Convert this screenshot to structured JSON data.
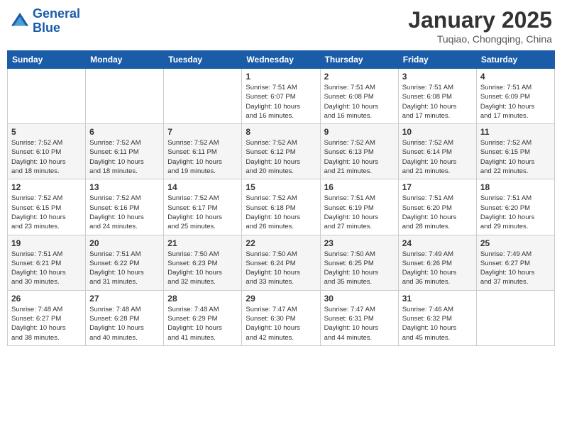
{
  "header": {
    "logo_line1": "General",
    "logo_line2": "Blue",
    "month_title": "January 2025",
    "subtitle": "Tuqiao, Chongqing, China"
  },
  "days_of_week": [
    "Sunday",
    "Monday",
    "Tuesday",
    "Wednesday",
    "Thursday",
    "Friday",
    "Saturday"
  ],
  "weeks": [
    [
      {
        "day": "",
        "info": ""
      },
      {
        "day": "",
        "info": ""
      },
      {
        "day": "",
        "info": ""
      },
      {
        "day": "1",
        "info": "Sunrise: 7:51 AM\nSunset: 6:07 PM\nDaylight: 10 hours\nand 16 minutes."
      },
      {
        "day": "2",
        "info": "Sunrise: 7:51 AM\nSunset: 6:08 PM\nDaylight: 10 hours\nand 16 minutes."
      },
      {
        "day": "3",
        "info": "Sunrise: 7:51 AM\nSunset: 6:08 PM\nDaylight: 10 hours\nand 17 minutes."
      },
      {
        "day": "4",
        "info": "Sunrise: 7:51 AM\nSunset: 6:09 PM\nDaylight: 10 hours\nand 17 minutes."
      }
    ],
    [
      {
        "day": "5",
        "info": "Sunrise: 7:52 AM\nSunset: 6:10 PM\nDaylight: 10 hours\nand 18 minutes."
      },
      {
        "day": "6",
        "info": "Sunrise: 7:52 AM\nSunset: 6:11 PM\nDaylight: 10 hours\nand 18 minutes."
      },
      {
        "day": "7",
        "info": "Sunrise: 7:52 AM\nSunset: 6:11 PM\nDaylight: 10 hours\nand 19 minutes."
      },
      {
        "day": "8",
        "info": "Sunrise: 7:52 AM\nSunset: 6:12 PM\nDaylight: 10 hours\nand 20 minutes."
      },
      {
        "day": "9",
        "info": "Sunrise: 7:52 AM\nSunset: 6:13 PM\nDaylight: 10 hours\nand 21 minutes."
      },
      {
        "day": "10",
        "info": "Sunrise: 7:52 AM\nSunset: 6:14 PM\nDaylight: 10 hours\nand 21 minutes."
      },
      {
        "day": "11",
        "info": "Sunrise: 7:52 AM\nSunset: 6:15 PM\nDaylight: 10 hours\nand 22 minutes."
      }
    ],
    [
      {
        "day": "12",
        "info": "Sunrise: 7:52 AM\nSunset: 6:15 PM\nDaylight: 10 hours\nand 23 minutes."
      },
      {
        "day": "13",
        "info": "Sunrise: 7:52 AM\nSunset: 6:16 PM\nDaylight: 10 hours\nand 24 minutes."
      },
      {
        "day": "14",
        "info": "Sunrise: 7:52 AM\nSunset: 6:17 PM\nDaylight: 10 hours\nand 25 minutes."
      },
      {
        "day": "15",
        "info": "Sunrise: 7:52 AM\nSunset: 6:18 PM\nDaylight: 10 hours\nand 26 minutes."
      },
      {
        "day": "16",
        "info": "Sunrise: 7:51 AM\nSunset: 6:19 PM\nDaylight: 10 hours\nand 27 minutes."
      },
      {
        "day": "17",
        "info": "Sunrise: 7:51 AM\nSunset: 6:20 PM\nDaylight: 10 hours\nand 28 minutes."
      },
      {
        "day": "18",
        "info": "Sunrise: 7:51 AM\nSunset: 6:20 PM\nDaylight: 10 hours\nand 29 minutes."
      }
    ],
    [
      {
        "day": "19",
        "info": "Sunrise: 7:51 AM\nSunset: 6:21 PM\nDaylight: 10 hours\nand 30 minutes."
      },
      {
        "day": "20",
        "info": "Sunrise: 7:51 AM\nSunset: 6:22 PM\nDaylight: 10 hours\nand 31 minutes."
      },
      {
        "day": "21",
        "info": "Sunrise: 7:50 AM\nSunset: 6:23 PM\nDaylight: 10 hours\nand 32 minutes."
      },
      {
        "day": "22",
        "info": "Sunrise: 7:50 AM\nSunset: 6:24 PM\nDaylight: 10 hours\nand 33 minutes."
      },
      {
        "day": "23",
        "info": "Sunrise: 7:50 AM\nSunset: 6:25 PM\nDaylight: 10 hours\nand 35 minutes."
      },
      {
        "day": "24",
        "info": "Sunrise: 7:49 AM\nSunset: 6:26 PM\nDaylight: 10 hours\nand 36 minutes."
      },
      {
        "day": "25",
        "info": "Sunrise: 7:49 AM\nSunset: 6:27 PM\nDaylight: 10 hours\nand 37 minutes."
      }
    ],
    [
      {
        "day": "26",
        "info": "Sunrise: 7:48 AM\nSunset: 6:27 PM\nDaylight: 10 hours\nand 38 minutes."
      },
      {
        "day": "27",
        "info": "Sunrise: 7:48 AM\nSunset: 6:28 PM\nDaylight: 10 hours\nand 40 minutes."
      },
      {
        "day": "28",
        "info": "Sunrise: 7:48 AM\nSunset: 6:29 PM\nDaylight: 10 hours\nand 41 minutes."
      },
      {
        "day": "29",
        "info": "Sunrise: 7:47 AM\nSunset: 6:30 PM\nDaylight: 10 hours\nand 42 minutes."
      },
      {
        "day": "30",
        "info": "Sunrise: 7:47 AM\nSunset: 6:31 PM\nDaylight: 10 hours\nand 44 minutes."
      },
      {
        "day": "31",
        "info": "Sunrise: 7:46 AM\nSunset: 6:32 PM\nDaylight: 10 hours\nand 45 minutes."
      },
      {
        "day": "",
        "info": ""
      }
    ]
  ]
}
